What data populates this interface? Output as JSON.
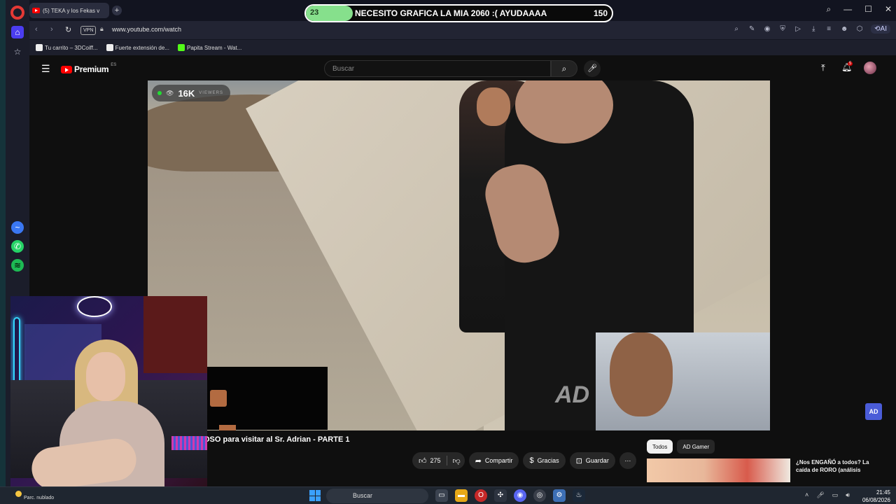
{
  "browser": {
    "tab_title": "(5) TEKA y los Fekas v",
    "url": "www.youtube.com/watch",
    "vpn_label": "VPN",
    "ai_label": "AI",
    "bookmarks": [
      {
        "label": "Tu carrito – 3DCoiff..."
      },
      {
        "label": "Fuerte extensión de..."
      },
      {
        "label": "Papita Stream - Wat..."
      }
    ]
  },
  "youtube": {
    "logo_text": "Premium",
    "region": "ES",
    "search_placeholder": "Buscar",
    "notification_count": "5",
    "video_title": "OSO para visitar al Sr. Adrian - PARTE 1",
    "like_count": "275",
    "share_label": "Compartir",
    "thanks_label": "Gracias",
    "save_label": "Guardar",
    "chips": [
      "Todos",
      "AD Gamer"
    ],
    "recommendation_title": "¿Nos ENGAÑÓ a todos? La caída de RORO (análisis"
  },
  "stream_overlay": {
    "viewer_count": "16K",
    "viewer_label": "VIEWERS",
    "goal_current": "23",
    "goal_max": "150",
    "goal_progress": 0.153,
    "goal_text": "NECESITO GRAFICA LA MIA 2060 :( AYUDAAAA",
    "accent": "#86e08c"
  },
  "watermark": {
    "text": "AD",
    "corner_text": "AD"
  },
  "taskbar": {
    "weather": "Parc. nublado",
    "search_placeholder": "Buscar",
    "time": "21:45",
    "date": "06/08/2026"
  }
}
